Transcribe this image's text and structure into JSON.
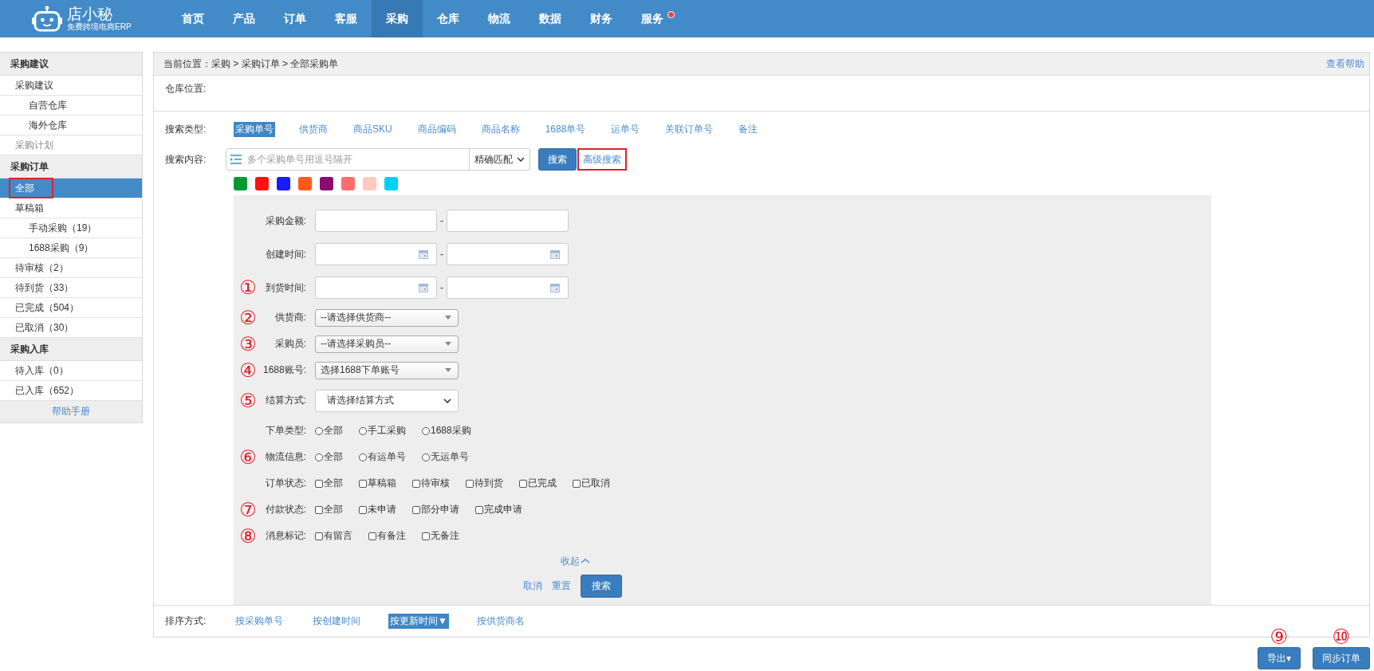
{
  "brand": {
    "name": "店小秘",
    "tagline": "免费跨境电商ERP"
  },
  "nav": [
    {
      "label": "首页",
      "selected": false,
      "badge": false
    },
    {
      "label": "产品",
      "selected": false,
      "badge": false
    },
    {
      "label": "订单",
      "selected": false,
      "badge": false
    },
    {
      "label": "客服",
      "selected": false,
      "badge": false
    },
    {
      "label": "采购",
      "selected": true,
      "badge": false
    },
    {
      "label": "仓库",
      "selected": false,
      "badge": false
    },
    {
      "label": "物流",
      "selected": false,
      "badge": false
    },
    {
      "label": "数据",
      "selected": false,
      "badge": false
    },
    {
      "label": "财务",
      "selected": false,
      "badge": false
    },
    {
      "label": "服务",
      "selected": false,
      "badge": true
    }
  ],
  "sidebar": {
    "sections": [
      {
        "title": "采购建议",
        "items": [
          {
            "label": "采购建议",
            "selected": false,
            "disabled": false,
            "outlined": false,
            "children": [
              {
                "label": "自营仓库",
                "selected": false,
                "disabled": false,
                "outlined": false
              },
              {
                "label": "海外仓库",
                "selected": false,
                "disabled": false,
                "outlined": false
              }
            ]
          },
          {
            "label": "采购计划",
            "selected": false,
            "disabled": true,
            "outlined": false
          }
        ]
      },
      {
        "title": "采购订单",
        "items": [
          {
            "label": "全部",
            "selected": true,
            "disabled": false,
            "outlined": true
          },
          {
            "label": "草稿箱",
            "selected": false,
            "disabled": false,
            "outlined": false,
            "children": [
              {
                "label": "手动采购（19）",
                "selected": false,
                "disabled": false,
                "outlined": false
              },
              {
                "label": "1688采购（9）",
                "selected": false,
                "disabled": false,
                "outlined": false
              }
            ]
          },
          {
            "label": "待审核（2）",
            "selected": false,
            "disabled": false,
            "outlined": false
          },
          {
            "label": "待到货（33）",
            "selected": false,
            "disabled": false,
            "outlined": false
          },
          {
            "label": "已完成（504）",
            "selected": false,
            "disabled": false,
            "outlined": false
          },
          {
            "label": "已取消（30）",
            "selected": false,
            "disabled": false,
            "outlined": false
          }
        ]
      },
      {
        "title": "采购入库",
        "items": [
          {
            "label": "待入库（0）",
            "selected": false,
            "disabled": false,
            "outlined": false
          },
          {
            "label": "已入库（652）",
            "selected": false,
            "disabled": false,
            "outlined": false
          }
        ]
      }
    ],
    "footer_link": "帮助手册"
  },
  "breadcrumb": "当前位置：采购 > 采购订单 > 全部采购单",
  "help_link": "查看帮助",
  "warehouse_label": "仓库位置:",
  "search_type": {
    "label": "搜索类型:",
    "options": [
      {
        "label": "采购单号",
        "selected": true
      },
      {
        "label": "供货商",
        "selected": false
      },
      {
        "label": "商品SKU",
        "selected": false
      },
      {
        "label": "商品编码",
        "selected": false
      },
      {
        "label": "商品名称",
        "selected": false
      },
      {
        "label": "1688单号",
        "selected": false
      },
      {
        "label": "运单号",
        "selected": false
      },
      {
        "label": "关联订单号",
        "selected": false
      },
      {
        "label": "备注",
        "selected": false
      }
    ]
  },
  "search_content": {
    "label": "搜索内容:",
    "placeholder": "多个采购单号用逗号隔开",
    "match": "精确匹配",
    "search_button": "搜索",
    "advanced_button": {
      "label": "高级搜索",
      "outlined": true
    }
  },
  "color_tags": [
    {
      "color": "#009a33"
    },
    {
      "color": "#ff1111"
    },
    {
      "color": "#1a1aff"
    },
    {
      "color": "#ff5a1a"
    },
    {
      "color": "#8b0a73"
    },
    {
      "color": "#ff6e6e"
    },
    {
      "color": "#ffc9c2"
    },
    {
      "color": "#00cff5"
    }
  ],
  "filters": [
    {
      "kind": "range",
      "label": "采购金额:",
      "separator": "-"
    },
    {
      "kind": "date_range",
      "label": "创建时间:",
      "separator": "-"
    },
    {
      "kind": "date_range",
      "label": "到货时间:",
      "marker": "①",
      "separator": "-"
    },
    {
      "kind": "select",
      "label": "供货商:",
      "value": "--请选择供货商--",
      "marker": "②"
    },
    {
      "kind": "select",
      "label": "采购员:",
      "value": "--请选择采购员--",
      "marker": "③"
    },
    {
      "kind": "select",
      "label": "1688账号:",
      "value": "选择1688下单账号",
      "marker": "④"
    },
    {
      "kind": "native_select",
      "label": "结算方式:",
      "value": "请选择结算方式",
      "marker": "⑤"
    },
    {
      "kind": "radios",
      "label": "下单类型:",
      "options": [
        {
          "label": "全部",
          "checked": false
        },
        {
          "label": "手工采购",
          "checked": false
        },
        {
          "label": "1688采购",
          "checked": false
        }
      ]
    },
    {
      "kind": "radios",
      "label": "物流信息:",
      "marker": "⑥",
      "options": [
        {
          "label": "全部",
          "checked": false
        },
        {
          "label": "有运单号",
          "checked": false
        },
        {
          "label": "无运单号",
          "checked": false
        }
      ]
    },
    {
      "kind": "checks",
      "label": "订单状态:",
      "options": [
        {
          "label": "全部",
          "checked": false
        },
        {
          "label": "草稿箱",
          "checked": false
        },
        {
          "label": "待审核",
          "checked": false
        },
        {
          "label": "待到货",
          "checked": false
        },
        {
          "label": "已完成",
          "checked": false
        },
        {
          "label": "已取消",
          "checked": false
        }
      ]
    },
    {
      "kind": "checks",
      "label": "付款状态:",
      "marker": "⑦",
      "options": [
        {
          "label": "全部",
          "checked": false
        },
        {
          "label": "未申请",
          "checked": false
        },
        {
          "label": "部分申请",
          "checked": false
        },
        {
          "label": "完成申请",
          "checked": false
        }
      ]
    },
    {
      "kind": "checks",
      "label": "消息标记:",
      "marker": "⑧",
      "options": [
        {
          "label": "有留言",
          "checked": false
        },
        {
          "label": "有备注",
          "checked": false
        },
        {
          "label": "无备注",
          "checked": false
        }
      ]
    }
  ],
  "collapse_link": "收起",
  "filter_actions": {
    "cancel": "取消",
    "reset": "重置",
    "search": "搜索"
  },
  "sort": {
    "label": "排序方式:",
    "options": [
      {
        "label": "按采购单号",
        "selected": false
      },
      {
        "label": "按创建时间",
        "selected": false
      },
      {
        "label": "按更新时间",
        "selected": true,
        "arrow": "▼"
      },
      {
        "label": "按供货商名",
        "selected": false
      }
    ]
  },
  "bottom_buttons": [
    {
      "label": "导出",
      "arrow": "▾",
      "marker": "⑨"
    },
    {
      "label": "同步订单",
      "marker": "⑩"
    }
  ]
}
